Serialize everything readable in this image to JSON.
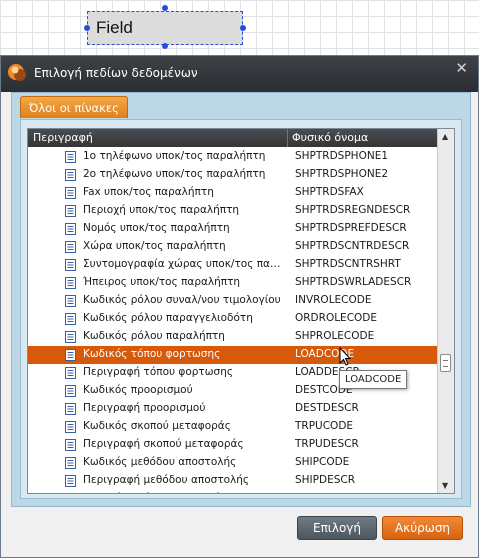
{
  "canvas_field": {
    "label": "Field"
  },
  "dialog": {
    "title": "Επιλογή πεδίων δεδομένων",
    "tab_label": "Όλοι οι πίνακες",
    "columns": {
      "description": "Περιγραφή",
      "physical_name": "Φυσικό όνομα"
    },
    "rows": [
      {
        "desc": "1ο τηλέφωνο υποκ/τος παραλήπτη",
        "phys": "SHPTRDSPHONE1"
      },
      {
        "desc": "2ο τηλέφωνο υποκ/τος παραλήπτη",
        "phys": "SHPTRDSPHONE2"
      },
      {
        "desc": "Fax υποκ/τος παραλήπτη",
        "phys": "SHPTRDSFAX"
      },
      {
        "desc": "Περιοχή υποκ/τος παραλήπτη",
        "phys": "SHPTRDSREGNDESCR"
      },
      {
        "desc": "Νομός υποκ/τος παραλήπτη",
        "phys": "SHPTRDSPREFDESCR"
      },
      {
        "desc": "Χώρα υποκ/τος παραλήπτη",
        "phys": "SHPTRDSCNTRDESCR"
      },
      {
        "desc": "Συντομογραφία χώρας υποκ/τος παρα...",
        "phys": "SHPTRDSCNTRSHRT"
      },
      {
        "desc": "Ήπειρος υποκ/τος παραλήπτη",
        "phys": "SHPTRDSWRLADESCR"
      },
      {
        "desc": "Κωδικός ρόλου συναλ/νου τιμολογίου",
        "phys": "INVROLECODE"
      },
      {
        "desc": "Κωδικός ρόλου παραγγελιοδότη",
        "phys": "ORDROLECODE"
      },
      {
        "desc": "Κωδικός ρόλου παραλήπτη",
        "phys": "SHPROLECODE"
      },
      {
        "desc": "Κωδικός τόπου φορτωσης",
        "phys": "LOADCODE"
      },
      {
        "desc": "Περιγραφή τόπου φορτωσης",
        "phys": "LOADDESCR"
      },
      {
        "desc": "Κωδικός προορισμού",
        "phys": "DESTCODE"
      },
      {
        "desc": "Περιγραφή προορισμού",
        "phys": "DESTDESCR"
      },
      {
        "desc": "Κωδικός σκοπού μεταφοράς",
        "phys": "TRPUCODE"
      },
      {
        "desc": "Περιγραφή σκοπού μεταφοράς",
        "phys": "TRPUDESCR"
      },
      {
        "desc": "Κωδικός μεθόδου αποστολής",
        "phys": "SHIPCODE"
      },
      {
        "desc": "Περιγραφή μεθόδου αποστολής",
        "phys": "SHIPDESCR"
      },
      {
        "desc": "Κωδικός τρόπου πληρωμής",
        "phys": "PAYMCODE"
      }
    ],
    "selected_row": 11,
    "tooltip": "LOADCODE",
    "ok_label": "Επιλογή",
    "cancel_label": "Ακύρωση",
    "close_icon": "close-icon",
    "colors": {
      "accent": "#e07f1c",
      "selection": "#d65a0a",
      "titlebar": "#2a2d31"
    }
  }
}
